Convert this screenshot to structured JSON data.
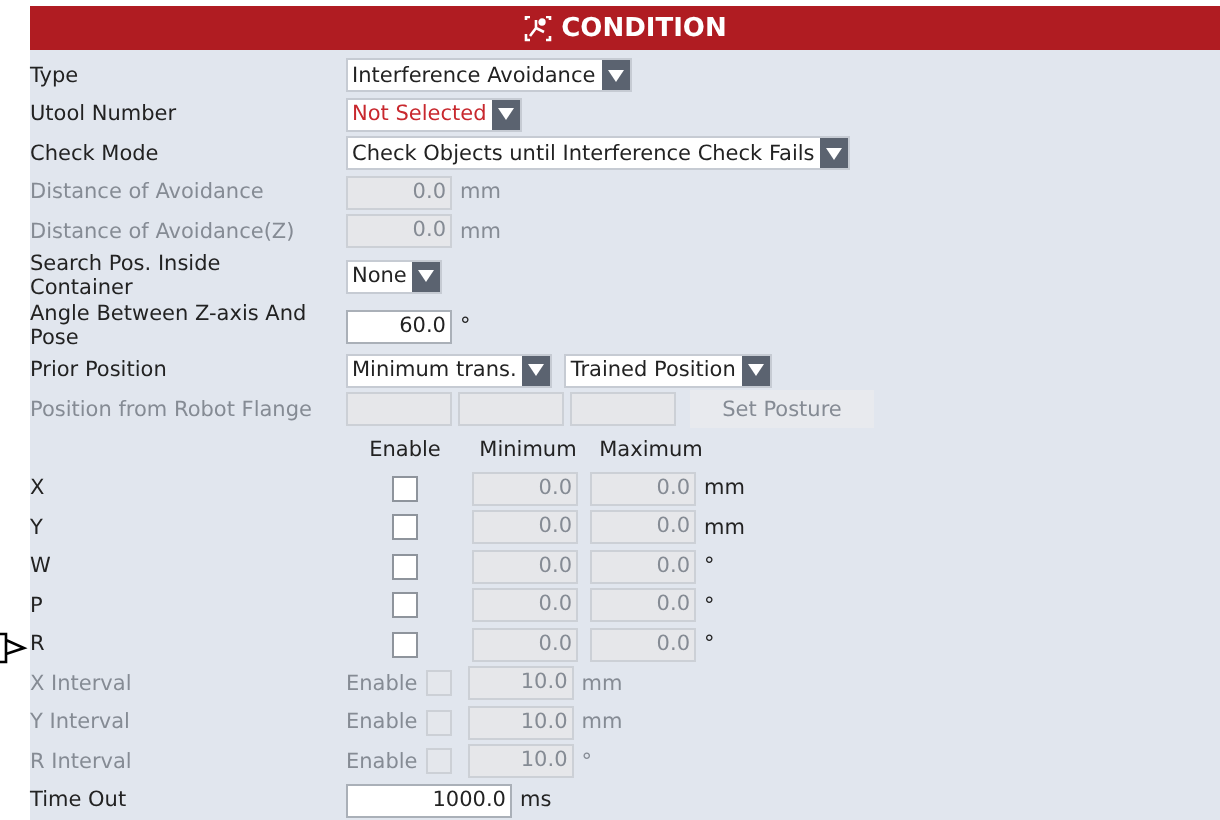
{
  "header": {
    "title": "CONDITION"
  },
  "rows": [
    {
      "kind": "select",
      "label": "Type",
      "value": "Interference Avoidance",
      "alert": false
    },
    {
      "kind": "select",
      "label": "Utool Number",
      "value": "Not Selected",
      "alert": true
    },
    {
      "kind": "select",
      "label": "Check Mode",
      "value": "Check Objects until Interference Check Fails",
      "alert": false
    },
    {
      "kind": "number",
      "label": "Distance of Avoidance",
      "value": "0.0",
      "unit": "mm",
      "disabled": true
    },
    {
      "kind": "number",
      "label": "Distance of Avoidance(Z)",
      "value": "0.0",
      "unit": "mm",
      "disabled": true
    },
    {
      "kind": "select",
      "label": "Search Pos. Inside Container",
      "value": "None",
      "alert": false
    },
    {
      "kind": "number",
      "label": "Angle Between Z-axis And Pose",
      "value": "60.0",
      "unit": "°",
      "disabled": false
    },
    {
      "kind": "select-pair",
      "label": "Prior Position",
      "values": [
        "Minimum trans.",
        "Trained Position"
      ]
    },
    {
      "kind": "posture",
      "label": "Position from Robot Flange",
      "button": "Set Posture",
      "disabled": true
    }
  ],
  "range_table": {
    "columns": [
      "Enable",
      "Minimum",
      "Maximum"
    ],
    "rows": [
      {
        "label": "X",
        "checked": false,
        "minimum": "0.0",
        "maximum": "0.0",
        "unit": "mm"
      },
      {
        "label": "Y",
        "checked": false,
        "minimum": "0.0",
        "maximum": "0.0",
        "unit": "mm"
      },
      {
        "label": "W",
        "checked": false,
        "minimum": "0.0",
        "maximum": "0.0",
        "unit": "°"
      },
      {
        "label": "P",
        "checked": false,
        "minimum": "0.0",
        "maximum": "0.0",
        "unit": "°"
      },
      {
        "label": "R",
        "checked": false,
        "minimum": "0.0",
        "maximum": "0.0",
        "unit": "°"
      }
    ]
  },
  "intervals": [
    {
      "label": "X Interval",
      "enable_label": "Enable",
      "checked": false,
      "value": "10.0",
      "unit": "mm",
      "disabled": true
    },
    {
      "label": "Y Interval",
      "enable_label": "Enable",
      "checked": false,
      "value": "10.0",
      "unit": "mm",
      "disabled": true
    },
    {
      "label": "R Interval",
      "enable_label": "Enable",
      "checked": false,
      "value": "10.0",
      "unit": "°",
      "disabled": true
    }
  ],
  "timeout": {
    "label": "Time Out",
    "value": "1000.0",
    "unit": "ms"
  }
}
